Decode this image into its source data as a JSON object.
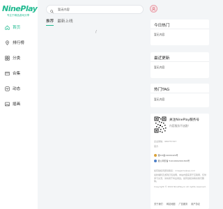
{
  "logo": {
    "name": "NinePlay",
    "tagline": "专注于精品游戏分享"
  },
  "nav": {
    "items": [
      {
        "label": "首页",
        "icon": "home-icon",
        "active": true
      },
      {
        "label": "排行榜",
        "icon": "location-pin-icon",
        "active": false
      },
      {
        "label": "分类",
        "icon": "grid-icon",
        "active": false
      },
      {
        "label": "合集",
        "icon": "folder-icon",
        "active": false
      },
      {
        "label": "动态",
        "icon": "activity-icon",
        "active": false
      },
      {
        "label": "插画",
        "icon": "image-icon",
        "active": false
      }
    ]
  },
  "search": {
    "placeholder": "暂无内容"
  },
  "tabs": [
    {
      "label": "推荐",
      "active": true
    },
    {
      "label": "最新上线",
      "active": false
    }
  ],
  "main": {
    "loading_mark": "/"
  },
  "sidebar_cards": {
    "today_hot": {
      "title": "今日热门",
      "item": "暂无内容"
    },
    "recent_update": {
      "title": "最近更新",
      "item": "暂无内容"
    },
    "hot_tag": {
      "title": "热门TAG",
      "item": "暂无内容"
    }
  },
  "follow": {
    "title": "关注NinePlay服务号",
    "subtitle": "内容服务不迷路！",
    "business_label": "企业微信：",
    "business_value": "980757347",
    "contact": "官方",
    "icp_line": "蜀ICP备19006429号",
    "police_line": "蜀公网安备 51010602001309号",
    "email_line": "如有版权问题请联系：ninegame@qq.com",
    "disclaimer": "最新福利及游戏打包说明，本站内容来源于互联网，仅供学习交流，请勿用于商业用途。如有侵权请联系我们删除。",
    "copyright": "Copyright © 2024 NinePlay.cn All rights reserved.",
    "footer_links": [
      "关于我们",
      "网站地图",
      "广告服务",
      "用户协议"
    ]
  },
  "colors": {
    "accent": "#1fb98f",
    "background": "#f3f5f7"
  }
}
